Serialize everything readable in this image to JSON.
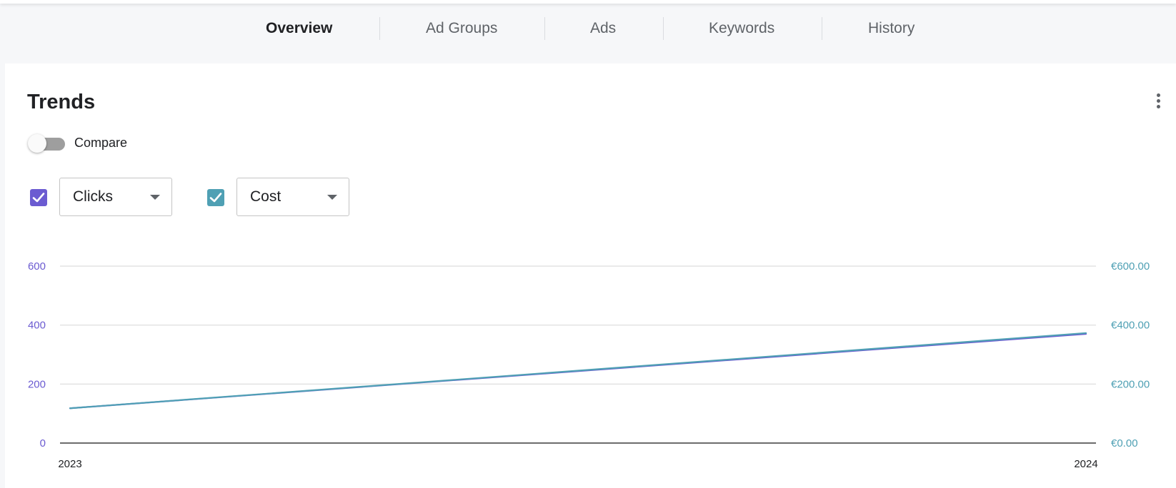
{
  "tabs": [
    {
      "label": "Overview",
      "active": true
    },
    {
      "label": "Ad Groups",
      "active": false
    },
    {
      "label": "Ads",
      "active": false
    },
    {
      "label": "Keywords",
      "active": false
    },
    {
      "label": "History",
      "active": false
    }
  ],
  "panel": {
    "title": "Trends",
    "menu_icon": "more-vert-icon",
    "compare_label": "Compare",
    "compare_enabled": false,
    "metric1": {
      "label": "Clicks",
      "checked": true,
      "color": "#6b5bd1"
    },
    "metric2": {
      "label": "Cost",
      "checked": true,
      "color": "#4fa0b4"
    }
  },
  "chart_data": {
    "type": "line",
    "x": [
      "2023",
      "2024"
    ],
    "series": [
      {
        "name": "Clicks",
        "axis": "left",
        "values": [
          118,
          370
        ],
        "color": "#6b5bd1"
      },
      {
        "name": "Cost",
        "axis": "right",
        "values": [
          118,
          373
        ],
        "color": "#4fa0b4"
      }
    ],
    "y_left": {
      "ticks": [
        "600",
        "400",
        "200",
        "0"
      ],
      "values": [
        600,
        400,
        200,
        0
      ],
      "ylim": [
        0,
        600
      ],
      "color": "#6b5bd1"
    },
    "y_right": {
      "ticks": [
        "€600.00",
        "€400.00",
        "€200.00",
        "€0.00"
      ],
      "values": [
        600,
        400,
        200,
        0
      ],
      "ylim": [
        0,
        600
      ],
      "color": "#4fa0b4"
    },
    "grid": true
  }
}
